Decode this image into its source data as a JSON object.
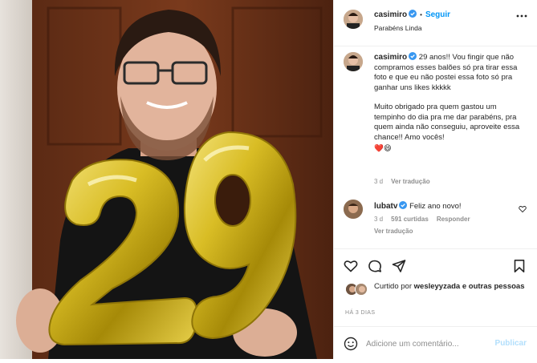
{
  "post": {
    "author": "casimiro",
    "follow_label": "Seguir",
    "location": "Parabéns Linda",
    "dot": "•",
    "caption": {
      "author": "casimiro",
      "paragraph1": "29 anos!! Vou fingir que não compramos esses balões só pra tirar essa foto e que eu não postei essa foto só pra ganhar uns likes kkkkk",
      "paragraph2": "Muito obrigado pra quem gastou um tempinho do dia pra me dar parabéns, pra quem ainda não conseguiu, aproveite essa chance!! Amo vocês!",
      "emojis": "❤️😄",
      "time": "3 d",
      "translate": "Ver tradução"
    },
    "comment": {
      "author": "lubatv",
      "text": "Feliz ano novo!",
      "time": "3 d",
      "likes": "591 curtidas",
      "reply": "Responder",
      "translate": "Ver tradução"
    },
    "likes": {
      "prefix": "Curtido por",
      "user": "wesleyyzada",
      "suffix": "e outras pessoas"
    },
    "timestamp": "HÁ 3 DIAS",
    "add_comment_placeholder": "Adicione um comentário...",
    "publish_label": "Publicar"
  },
  "photo": {
    "balloon_digits": "29",
    "balloon_color": "#d4b81c"
  },
  "colors": {
    "accent": "#0095f6",
    "verified": "#3897f0",
    "muted": "#8e8e8e",
    "publish_disabled": "#b2dffc"
  }
}
